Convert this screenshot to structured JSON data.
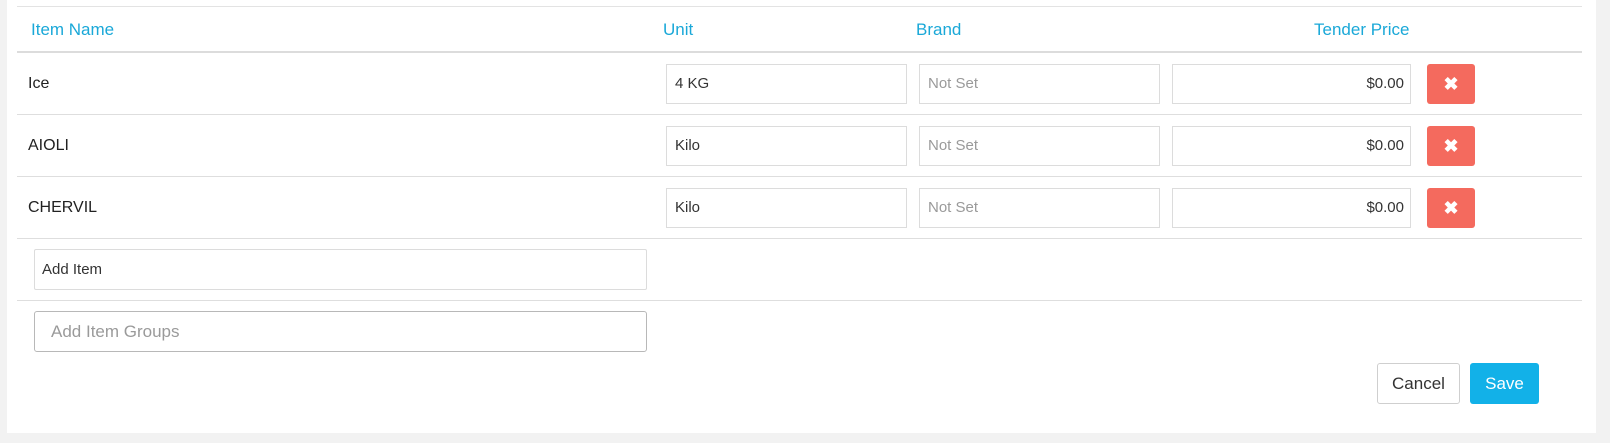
{
  "columns": {
    "item_name": "Item Name",
    "unit": "Unit",
    "brand": "Brand",
    "tender_price": "Tender Price"
  },
  "rows": [
    {
      "name": "Ice",
      "unit": "4 KG",
      "brand": "Not Set",
      "price": "$0.00"
    },
    {
      "name": "AIOLI",
      "unit": "Kilo",
      "brand": "Not Set",
      "price": "$0.00"
    },
    {
      "name": "CHERVIL",
      "unit": "Kilo",
      "brand": "Not Set",
      "price": "$0.00"
    }
  ],
  "add_item": {
    "label": "Add Item"
  },
  "add_item_groups": {
    "placeholder": "Add Item Groups"
  },
  "buttons": {
    "cancel": "Cancel",
    "save": "Save",
    "delete_glyph": "✖"
  },
  "colors": {
    "accent": "#1aa8d8",
    "danger": "#f46a5e",
    "primary": "#12b1e8"
  }
}
